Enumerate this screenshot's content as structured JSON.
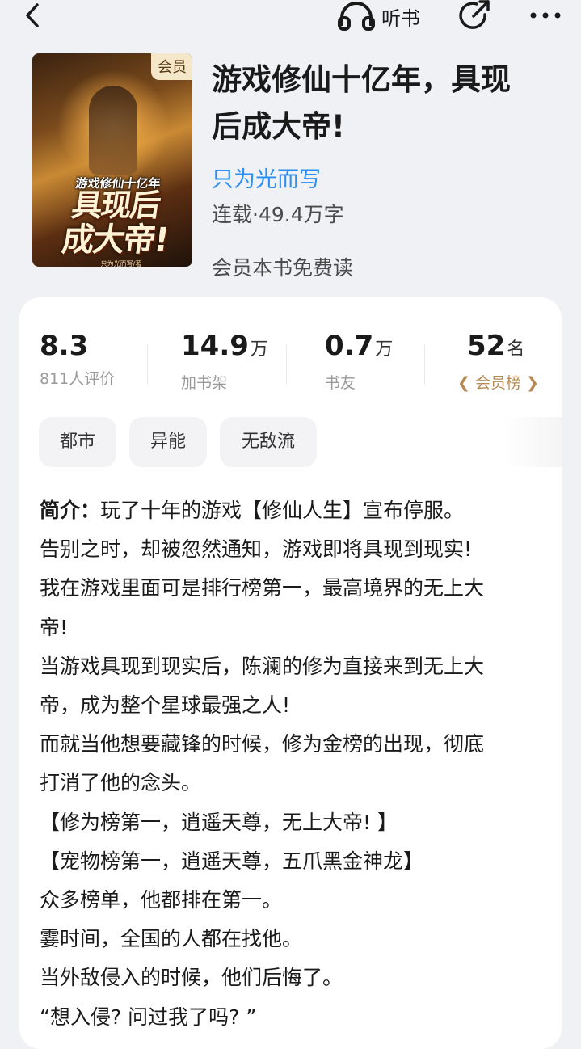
{
  "topbar": {
    "listen_label": "听书"
  },
  "book": {
    "cover_badge": "会员",
    "cover_title_small": "游戏修仙十亿年",
    "cover_title_big_1": "具现后",
    "cover_title_big_2": "成大帝!",
    "cover_author": "只为光而写/著",
    "title_line1": "游戏修仙十亿年，具现",
    "title_line2": "后成大帝!",
    "author": "只为光而写",
    "meta": "连载·49.4万字",
    "vip_free": "会员本书免费读"
  },
  "stats": [
    {
      "value": "8.3",
      "unit": "",
      "label": "811人评价"
    },
    {
      "value": "14.9",
      "unit": "万",
      "label": "加书架"
    },
    {
      "value": "0.7",
      "unit": "万",
      "label": "书友"
    },
    {
      "value": "52",
      "unit": "名",
      "label": "会员榜"
    }
  ],
  "tags": [
    "都市",
    "异能",
    "无敌流"
  ],
  "intro": {
    "label": "简介：",
    "first": "玩了十年的游戏【修仙人生】宣布停服。",
    "lines": [
      "告别之时，却被忽然通知，游戏即将具现到现实!",
      "我在游戏里面可是排行榜第一，最高境界的无上大",
      "帝!",
      "当游戏具现到现实后，陈澜的修为直接来到无上大",
      "帝，成为整个星球最强之人!",
      "而就当他想要藏锋的时候，修为金榜的出现，彻底",
      "打消了他的念头。",
      "【修为榜第一，逍遥天尊，无上大帝! 】",
      "【宠物榜第一，逍遥天尊，五爪黑金神龙】",
      "众多榜单，他都排在第一。",
      "霎时间，全国的人都在找他。",
      "当外敌侵入的时候，他们后悔了。",
      "“想入侵? 问过我了吗? ”"
    ]
  }
}
